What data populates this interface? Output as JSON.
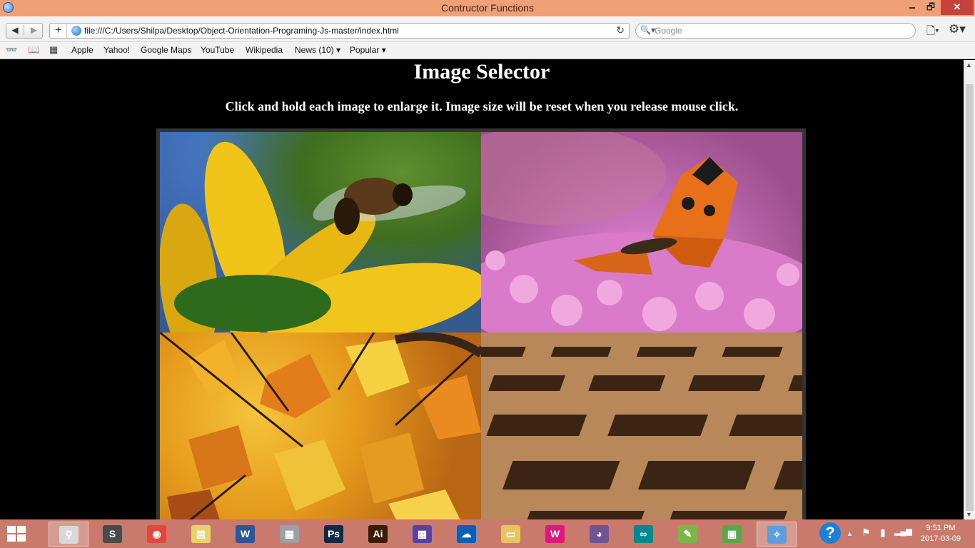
{
  "window": {
    "title": "Contructor Functions",
    "minimize": "🗕",
    "maximize": "🗗",
    "close": "✕"
  },
  "toolbar": {
    "back": "◀",
    "forward": "▶",
    "add": "+",
    "url": "file:///C:/Users/Shilpa/Desktop/Object-Orientation-Programing-Js-master/index.html",
    "reload": "↻",
    "search_icon": "🔍▾",
    "search_placeholder": "Google",
    "page_menu": "🗋▾",
    "gear_menu": "⚙▾"
  },
  "bookmarks": {
    "reading_list_icon": "👓",
    "bookmarks_icon": "📖",
    "top_sites_icon": "▦",
    "items": [
      "Apple",
      "Yahoo!",
      "Google Maps",
      "YouTube",
      "Wikipedia",
      "News (10) ▾",
      "Popular ▾"
    ]
  },
  "page": {
    "heading": "Image Selector",
    "instructions": "Click and hold each image to enlarge it. Image size will be reset when you release mouse click.",
    "images": [
      "bee-on-yellow-flower",
      "butterfly-on-pink-flowers",
      "autumn-leaves",
      "brick-pattern"
    ]
  },
  "scrollbar": {
    "up": "▲",
    "down": "▼"
  },
  "taskbar": {
    "apps": [
      {
        "name": "magnifier",
        "glyph": "⚲",
        "color": "#d8d8d8"
      },
      {
        "name": "sublime-text",
        "glyph": "S",
        "color": "#4a4a4a"
      },
      {
        "name": "chrome",
        "glyph": "◉",
        "color": "#e0483e"
      },
      {
        "name": "sticky-notes",
        "glyph": "▤",
        "color": "#e8d36a"
      },
      {
        "name": "word",
        "glyph": "W",
        "color": "#2b579a"
      },
      {
        "name": "calculator",
        "glyph": "▦",
        "color": "#9aa0a6"
      },
      {
        "name": "photoshop",
        "glyph": "Ps",
        "color": "#0f2a47"
      },
      {
        "name": "illustrator",
        "glyph": "Ai",
        "color": "#3a1c05"
      },
      {
        "name": "calendar",
        "glyph": "▦",
        "color": "#5b3fa3"
      },
      {
        "name": "onedrive",
        "glyph": "☁",
        "color": "#0d5fb5"
      },
      {
        "name": "file-explorer",
        "glyph": "▭",
        "color": "#e8c560"
      },
      {
        "name": "wampserver",
        "glyph": "W",
        "color": "#e2177a"
      },
      {
        "name": "github",
        "glyph": "◕",
        "color": "#6e5494"
      },
      {
        "name": "arduino",
        "glyph": "∞",
        "color": "#00878f"
      },
      {
        "name": "notepad-plus",
        "glyph": "✎",
        "color": "#7ab648"
      },
      {
        "name": "xampp-control",
        "glyph": "▣",
        "color": "#58a84a"
      },
      {
        "name": "safari",
        "glyph": "✧",
        "color": "#5aa0e0"
      }
    ],
    "tray": {
      "help": "?",
      "chevron": "▲",
      "flag": "⚑",
      "network": "▮",
      "signal": "▂▄▆"
    },
    "time": "9:51 PM",
    "date": "2017-03-09"
  }
}
